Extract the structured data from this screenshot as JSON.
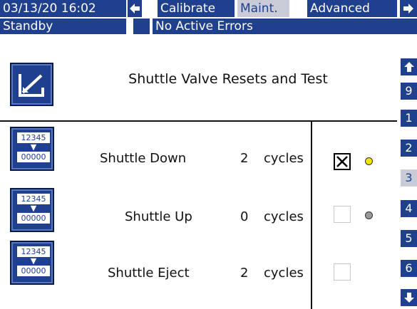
{
  "header": {
    "datetime": "03/13/20 16:02",
    "tabs": [
      {
        "label": "Calibrate"
      },
      {
        "label": "Maint."
      },
      {
        "label": "Advanced"
      }
    ]
  },
  "status": {
    "state": "Standby",
    "errors": "No Active Errors"
  },
  "page": {
    "title": "Shuttle Valve Resets and Test"
  },
  "rows": [
    {
      "label": "Shuttle Down",
      "count": "2",
      "unit": "cycles",
      "checked": true,
      "indicator_color": "#f2e400"
    },
    {
      "label": "Shuttle Up",
      "count": "0",
      "unit": "cycles",
      "checked": false,
      "indicator_color": "#9a9a9a"
    },
    {
      "label": "Shuttle Eject",
      "count": "2",
      "unit": "cycles",
      "checked": false
    }
  ],
  "reset_icon": {
    "top": "12345",
    "bottom": "00000"
  },
  "side_pages": [
    "9",
    "1",
    "2",
    "3",
    "4",
    "5",
    "6"
  ],
  "selected_page": "3",
  "colors": {
    "primary": "#1f3f8f",
    "selected": "#c9ccd6",
    "indicator_on": "#f2e400",
    "indicator_off": "#9a9a9a"
  }
}
